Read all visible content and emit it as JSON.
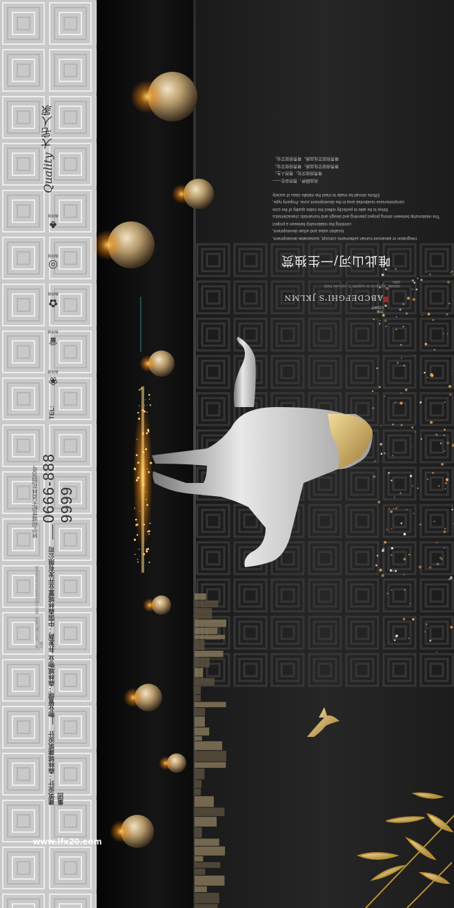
{
  "brand": {
    "tagline": "Quality 大宅人家"
  },
  "contact": {
    "tel_label": "TEL:",
    "tel_number": "0666-888 9999",
    "address": "将宁印城世纪大道林花园30号"
  },
  "credits": {
    "developer": "开发商：中国森林城置业开发有限公司",
    "property": "物业管理：森林城物业",
    "architect": "建筑设计：森林城建筑设计集团",
    "fine_print": "本广告仅为要约邀请，最终以政府批准文件及买卖合同为准"
  },
  "logos": [
    {
      "name": "tree-logo-icon",
      "caption": "森林城"
    },
    {
      "name": "ring-logo-icon",
      "caption": "森林城"
    },
    {
      "name": "lotus-logo-icon",
      "caption": "森林城"
    },
    {
      "name": "crown-logo-icon",
      "caption": "森林城"
    },
    {
      "name": "flower-logo-icon",
      "caption": "森林城"
    }
  ],
  "headline": "唯此山河/一生独赏",
  "headline_sub": "Abode, lightless or superb to venues held elite",
  "english_name": "ABCDEFGHI'S JKLMN",
  "court_label": "THE COURT",
  "body_lines": [
    "Integration of advanced human settlements concept, sustainable development,",
    "location value and urban development,",
    "combing the relationship between a project",
    "The relationship between strong project planning and design and humanistic characteristics",
    "Strive to be able to perfectly reflect the noble quality of the core",
    "comprehensive residential area in the development zone. Property type,",
    "Efforts should be made to meet the middle class of society",
    "",
    "尚品颐养，悠然自在——",
    "尊贵府邸文化，悠然人生。",
    "尊贵府邸文化品质，尊贵府邸文化。",
    "尊贵府邸文化品质，尊贵府邸文化。"
  ],
  "watermark": "www.lfx20.com",
  "colors": {
    "gold": "#c9a64a",
    "seal_red": "#a5262b",
    "strip_grey": "#c9c9c9"
  }
}
